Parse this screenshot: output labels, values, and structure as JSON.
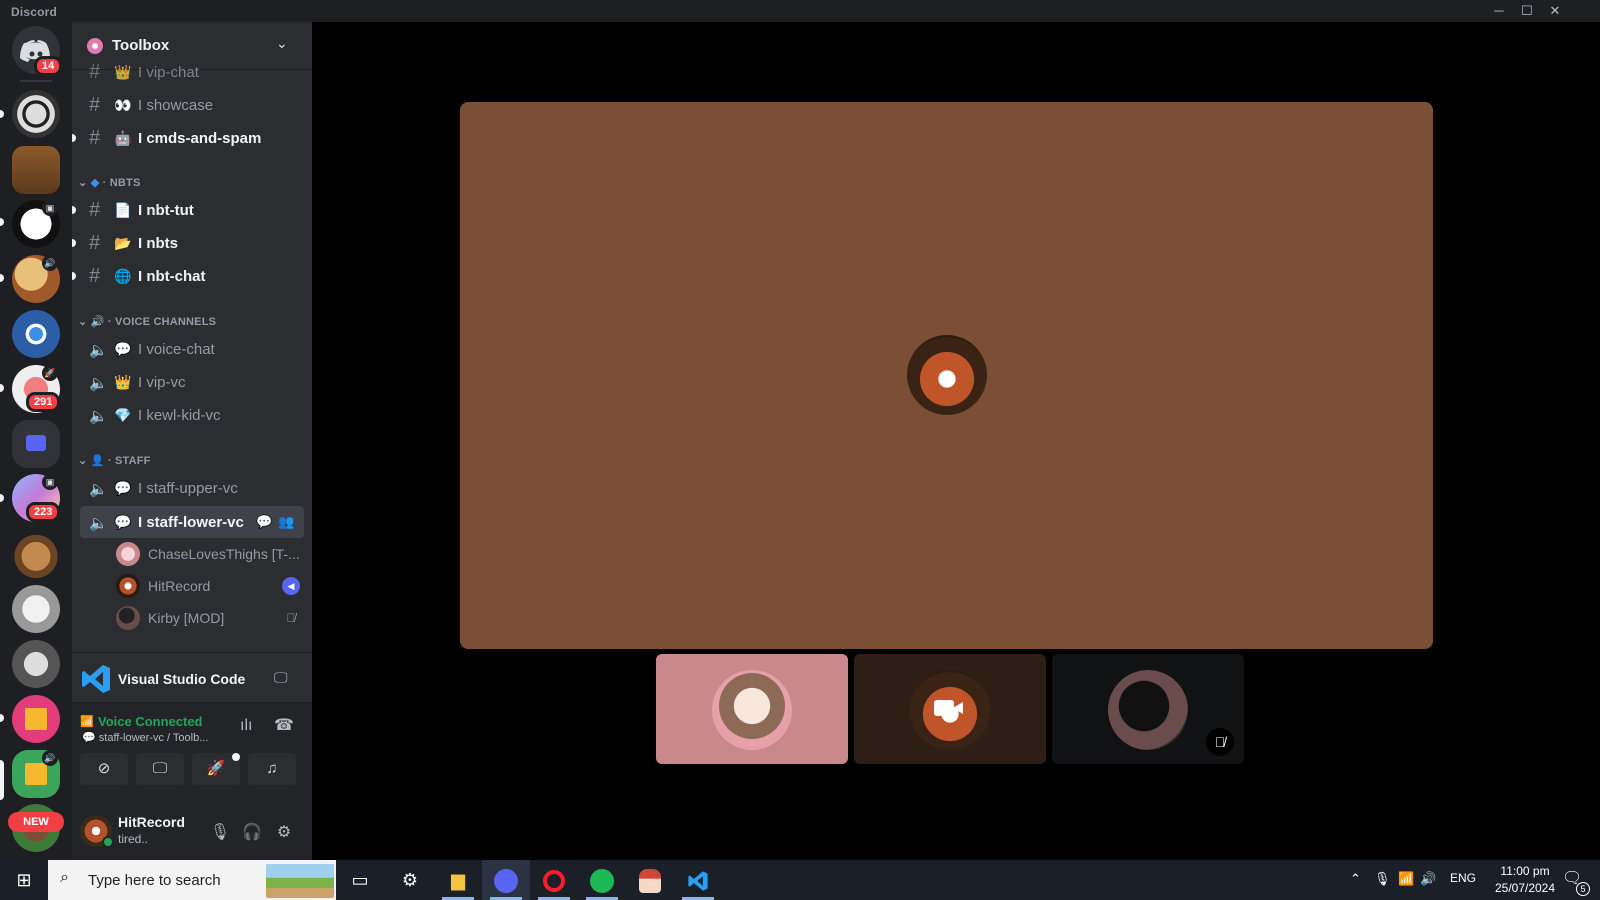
{
  "window": {
    "title": "Discord",
    "minimize": "─",
    "maximize": "☐",
    "close": "✕"
  },
  "rail": {
    "home_badge": "14",
    "badge_291": "291",
    "badge_223": "223",
    "new_label": "NEW"
  },
  "guild": {
    "name": "Toolbox"
  },
  "channels": {
    "vip_chat": {
      "emoji": "👑",
      "name": "I vip-chat"
    },
    "showcase": {
      "emoji": "👀",
      "name": "I showcase"
    },
    "cmds": {
      "emoji": "🤖",
      "name": "I cmds-and-spam"
    },
    "cat_nbts": "· NBTS",
    "nbt_tut": {
      "emoji": "📄",
      "name": "I nbt-tut"
    },
    "nbts": {
      "emoji": "📂",
      "name": "I nbts"
    },
    "nbt_chat": {
      "emoji": "🌐",
      "name": "I nbt-chat"
    },
    "cat_voice": "· VOICE CHANNELS",
    "voice_chat": {
      "emoji": "💬",
      "name": "I voice-chat"
    },
    "vip_vc": {
      "emoji": "👑",
      "name": "I vip-vc"
    },
    "kewl": {
      "emoji": "💎",
      "name": "I kewl-kid-vc"
    },
    "cat_staff": "· STAFF",
    "staff_upper": {
      "emoji": "💬",
      "name": "I staff-upper-vc"
    },
    "staff_lower": {
      "emoji": "💬",
      "name": "I staff-lower-vc"
    }
  },
  "voice_users": [
    {
      "name": "ChaseLovesThighs [T-..."
    },
    {
      "name": "HitRecord"
    },
    {
      "name": "Kirby [MOD]"
    }
  ],
  "activity": {
    "name": "Visual Studio Code"
  },
  "voice": {
    "status": "Voice Connected",
    "location": "staff-lower-vc / Toolb..."
  },
  "user": {
    "name": "HitRecord",
    "status": "tired.."
  },
  "taskbar": {
    "search_placeholder": "Type here to search",
    "lang": "ENG",
    "time": "11:00 pm",
    "date": "25/07/2024",
    "notif_count": "5"
  },
  "colors": {
    "discord_blurple": "#5865f2",
    "voice_green": "#23a55a",
    "badge_red": "#f23f43",
    "main_tile_bg": "#7b4f35",
    "tile_pink": "#c9898c"
  }
}
